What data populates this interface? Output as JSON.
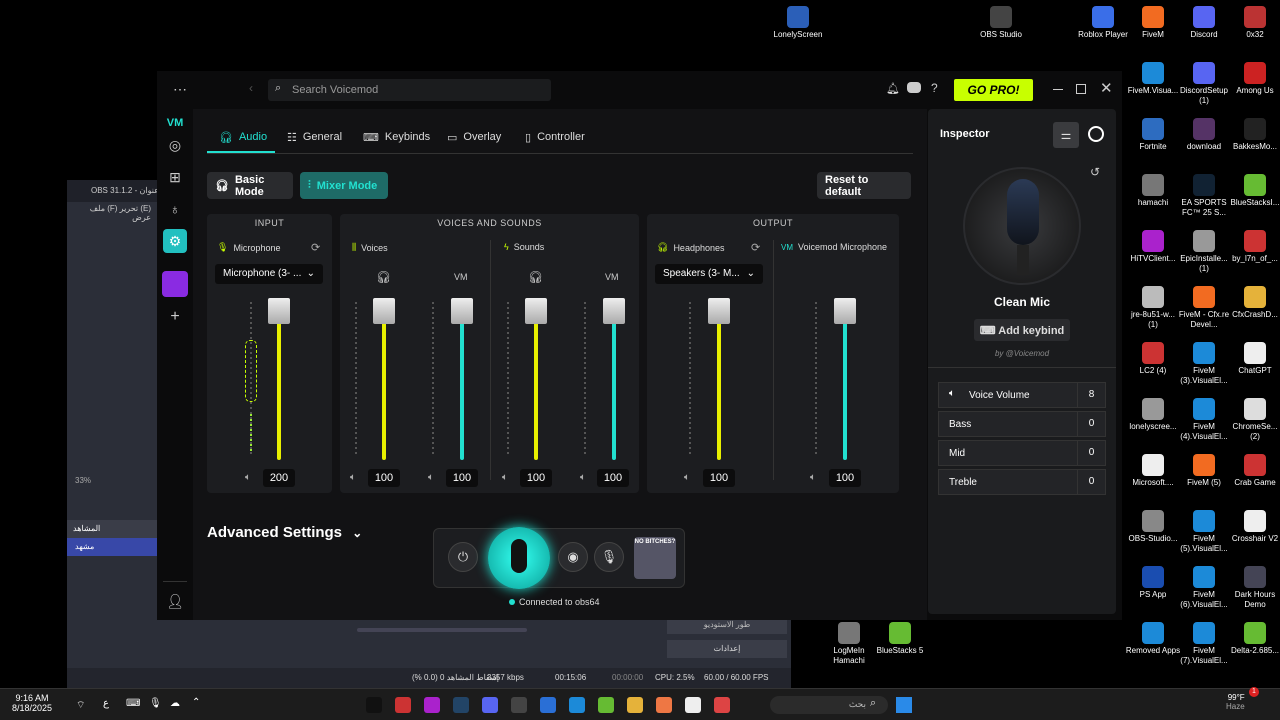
{
  "desktop": {
    "icons": [
      {
        "label": "LonelyScreen",
        "color": "#2b5fb8"
      },
      {
        "label": "OBS Studio",
        "color": "#444"
      },
      {
        "label": "Roblox Player",
        "color": "#3a6ee8"
      },
      {
        "label": "FiveM",
        "color": "#f26b21"
      },
      {
        "label": "Discord",
        "color": "#5865f2"
      },
      {
        "label": "0x32",
        "color": "#b33"
      },
      {
        "label": "FiveM.Visua...",
        "color": "#1c8ad8"
      },
      {
        "label": "DiscordSetup (1)",
        "color": "#5865f2"
      },
      {
        "label": "Among Us",
        "color": "#c22"
      },
      {
        "label": "Fortnite",
        "color": "#2d6cc0"
      },
      {
        "label": "download",
        "color": "#536"
      },
      {
        "label": "BakkesMo...",
        "color": "#222"
      },
      {
        "label": "hamachi",
        "color": "#777"
      },
      {
        "label": "EA SPORTS FC™ 25 S...",
        "color": "#123"
      },
      {
        "label": "BlueStacksI...",
        "color": "#6b3"
      },
      {
        "label": "HiTVClient...",
        "color": "#a2c"
      },
      {
        "label": "EpicInstalle... (1)",
        "color": "#999"
      },
      {
        "label": "by_l7n_of_...",
        "color": "#c33"
      },
      {
        "label": "jre-8u51-w... (1)",
        "color": "#bbb"
      },
      {
        "label": "FiveM - Cfx.re Devel...",
        "color": "#f26b21"
      },
      {
        "label": "CfxCrashD...",
        "color": "#e5b23a"
      },
      {
        "label": "LC2 (4)",
        "color": "#c33"
      },
      {
        "label": "FiveM (3).VisualEl...",
        "color": "#1c8ad8"
      },
      {
        "label": "ChatGPT",
        "color": "#eee"
      },
      {
        "label": "lonelyscree...",
        "color": "#999"
      },
      {
        "label": "FiveM (4).VisualEl...",
        "color": "#1c8ad8"
      },
      {
        "label": "ChromeSe... (2)",
        "color": "#ddd"
      },
      {
        "label": "Microsoft....",
        "color": "#eee"
      },
      {
        "label": "FiveM (5)",
        "color": "#f26b21"
      },
      {
        "label": "Crab Game",
        "color": "#c33"
      },
      {
        "label": "OBS-Studio...",
        "color": "#888"
      },
      {
        "label": "FiveM (5).VisualEl...",
        "color": "#1c8ad8"
      },
      {
        "label": "Crosshair V2",
        "color": "#eee"
      },
      {
        "label": "PS App",
        "color": "#1a4db0"
      },
      {
        "label": "FiveM (6).VisualEl...",
        "color": "#1c8ad8"
      },
      {
        "label": "Dark Hours Demo",
        "color": "#445"
      },
      {
        "label": "Removed Apps",
        "color": "#1c8ad8"
      },
      {
        "label": "FiveM (7).VisualEl...",
        "color": "#1c8ad8"
      },
      {
        "label": "Delta-2.685...",
        "color": "#6b3"
      },
      {
        "label": "LogMeIn Hamachi",
        "color": "#777"
      },
      {
        "label": "BlueStacks 5",
        "color": "#6b3"
      }
    ]
  },
  "obs": {
    "title": "OBS 31.1.2 - عنوان",
    "menu": "ملف (F)   تحرير (E)   عرض",
    "zoom": "33%",
    "scenes_header": "المشاهد",
    "scene_item": "مشهد",
    "studio_mode": "طور الاستوديو",
    "settings": "إعدادات",
    "status": {
      "dropped": "إسقاط المشاهد 0 (0.0 %)",
      "kbps": "3357 kbps",
      "rec_time": "00:15:06",
      "stream_time": "00:00:00",
      "cpu": "CPU: 2.5%",
      "fps": "60.00 / 60.00 FPS"
    }
  },
  "voicemod": {
    "search_placeholder": "Search Voicemod",
    "gopro": "GO PRO!",
    "tabs": [
      "Audio",
      "General",
      "Keybinds",
      "Overlay",
      "Controller"
    ],
    "modes": {
      "basic": "Basic Mode",
      "mixer": "Mixer Mode"
    },
    "reset": "Reset to default",
    "panels": {
      "input": "INPUT",
      "voices_sounds": "VOICES AND SOUNDS",
      "output": "OUTPUT"
    },
    "channels": {
      "microphone": {
        "label": "Microphone",
        "device": "Microphone (3- ...",
        "volume": "200"
      },
      "voices": {
        "label": "Voices",
        "vol_headphones": "100",
        "vol_voicemod": "100"
      },
      "sounds": {
        "label": "Sounds",
        "vol_headphones": "100",
        "vol_voicemod": "100"
      },
      "headphones": {
        "label": "Headphones",
        "device": "Speakers (3- M...",
        "volume": "100"
      },
      "vm_mic": {
        "label": "Voicemod Microphone",
        "volume": "100"
      }
    },
    "advanced": "Advanced Settings",
    "connected": "Connected to obs64",
    "inspector": {
      "title": "Inspector",
      "voice_name": "Clean Mic",
      "add_keybind": "Add keybind",
      "by": "by @Voicemod",
      "params": [
        {
          "label": "Voice Volume",
          "value": "8"
        },
        {
          "label": "Bass",
          "value": "0"
        },
        {
          "label": "Mid",
          "value": "0"
        },
        {
          "label": "Treble",
          "value": "0"
        }
      ]
    },
    "meme_text": "NO BITCHES?"
  },
  "taskbar": {
    "time": "9:16 AM",
    "date": "8/18/2025",
    "lang": "ع",
    "search_placeholder": "بحث",
    "weather_temp": "99°F",
    "weather_desc": "Haze",
    "notif_count": "1"
  },
  "colors": {
    "accent": "#22e0d0",
    "yellow": "#e8f000",
    "gopro": "#c8ff00"
  }
}
